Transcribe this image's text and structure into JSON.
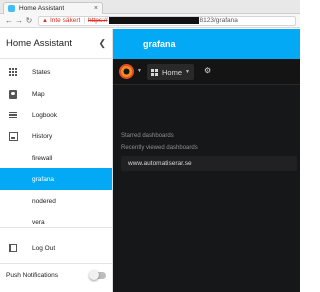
{
  "browser": {
    "tab_title": "Home Assistant",
    "tab_close": "×",
    "insecure_label": "Inte säkert",
    "url_scheme": "https://",
    "url_tail": "8123/grafana"
  },
  "sidebar": {
    "title": "Home Assistant",
    "items": [
      {
        "label": "States",
        "icon": "grid-icon"
      },
      {
        "label": "Map",
        "icon": "map-person-icon"
      },
      {
        "label": "Logbook",
        "icon": "list-icon"
      },
      {
        "label": "History",
        "icon": "history-chart-icon"
      },
      {
        "label": "firewall",
        "icon": ""
      },
      {
        "label": "grafana",
        "icon": "",
        "active": true
      },
      {
        "label": "nodered",
        "icon": ""
      },
      {
        "label": "vera",
        "icon": ""
      },
      {
        "label": "Log Out",
        "icon": "logout-icon"
      }
    ],
    "push_label": "Push Notifications",
    "push_enabled": false
  },
  "main": {
    "title": "grafana"
  },
  "grafana": {
    "home_label": "Home",
    "starred_heading": "Starred dashboards",
    "recent_heading": "Recently viewed dashboards",
    "recent_items": [
      "www.automatiserar.se"
    ]
  },
  "colors": {
    "accent": "#03a9f4",
    "grafana_bg": "#161719",
    "insecure": "#d93025"
  }
}
